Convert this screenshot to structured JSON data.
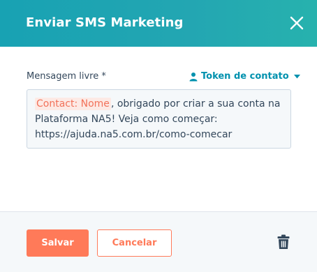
{
  "dialog": {
    "title": "Enviar SMS Marketing"
  },
  "form": {
    "field_label": "Mensagem livre *",
    "token_link": "Token de contato",
    "message_token": "Contact: Nome",
    "message_text": ", obrigado por criar a sua conta na Plataforma NA5! Veja como começar: https://ajuda.na5.com.br/como-comecar"
  },
  "footer": {
    "save_label": "Salvar",
    "cancel_label": "Cancelar"
  },
  "icons": {
    "close": "close-icon",
    "person": "person-icon",
    "caret": "caret-down-icon",
    "trash": "trash-icon"
  },
  "colors": {
    "header": "#23a6b2",
    "accent": "#ff7a59",
    "link": "#0091ae",
    "token_bg": "#fdeae5",
    "token_text": "#f2725a"
  }
}
